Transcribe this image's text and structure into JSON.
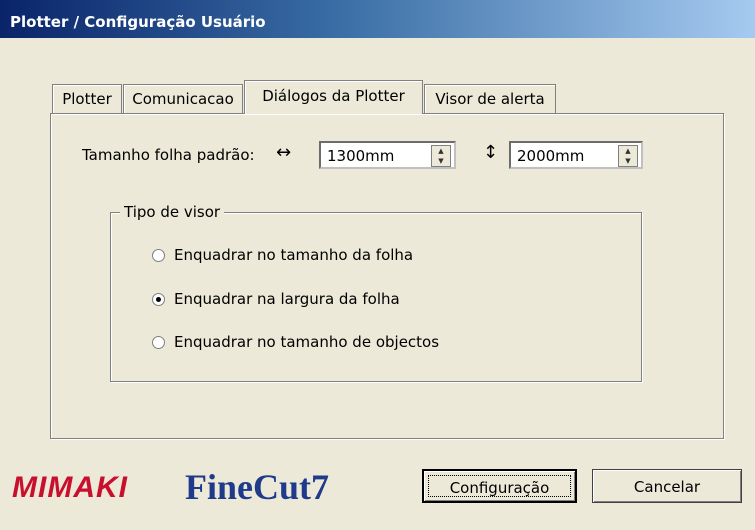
{
  "window": {
    "title": "Plotter / Configuração Usuário"
  },
  "tabs": [
    {
      "label": "Plotter",
      "active": false
    },
    {
      "label": "Comunicacao",
      "active": false
    },
    {
      "label": "Diálogos da Plotter",
      "active": true
    },
    {
      "label": "Visor de alerta",
      "active": false
    }
  ],
  "paper_size": {
    "label": "Tamanho folha padrão:",
    "width_icon": "horizontal-resize-arrow",
    "width_symbol": "↔",
    "width_value": "1300mm",
    "height_icon": "vertical-resize-arrow",
    "height_symbol": "↕",
    "height_value": "2000mm"
  },
  "view_type": {
    "legend": "Tipo de visor",
    "options": [
      {
        "label": "Enquadrar no tamanho da folha",
        "selected": false
      },
      {
        "label": "Enquadrar na largura da folha",
        "selected": true
      },
      {
        "label": "Enquadrar no tamanho de objectos",
        "selected": false
      }
    ]
  },
  "footer": {
    "logo_mimaki": "MIMAKI",
    "logo_finecut": "FineCut7",
    "config_button": "Configuração",
    "cancel_button": "Cancelar"
  },
  "colors": {
    "title_bar": "#0a246a",
    "dialog_bg": "#ece9d8",
    "mimaki_red": "#c8102e",
    "finecut_blue": "#1f3a8a"
  }
}
